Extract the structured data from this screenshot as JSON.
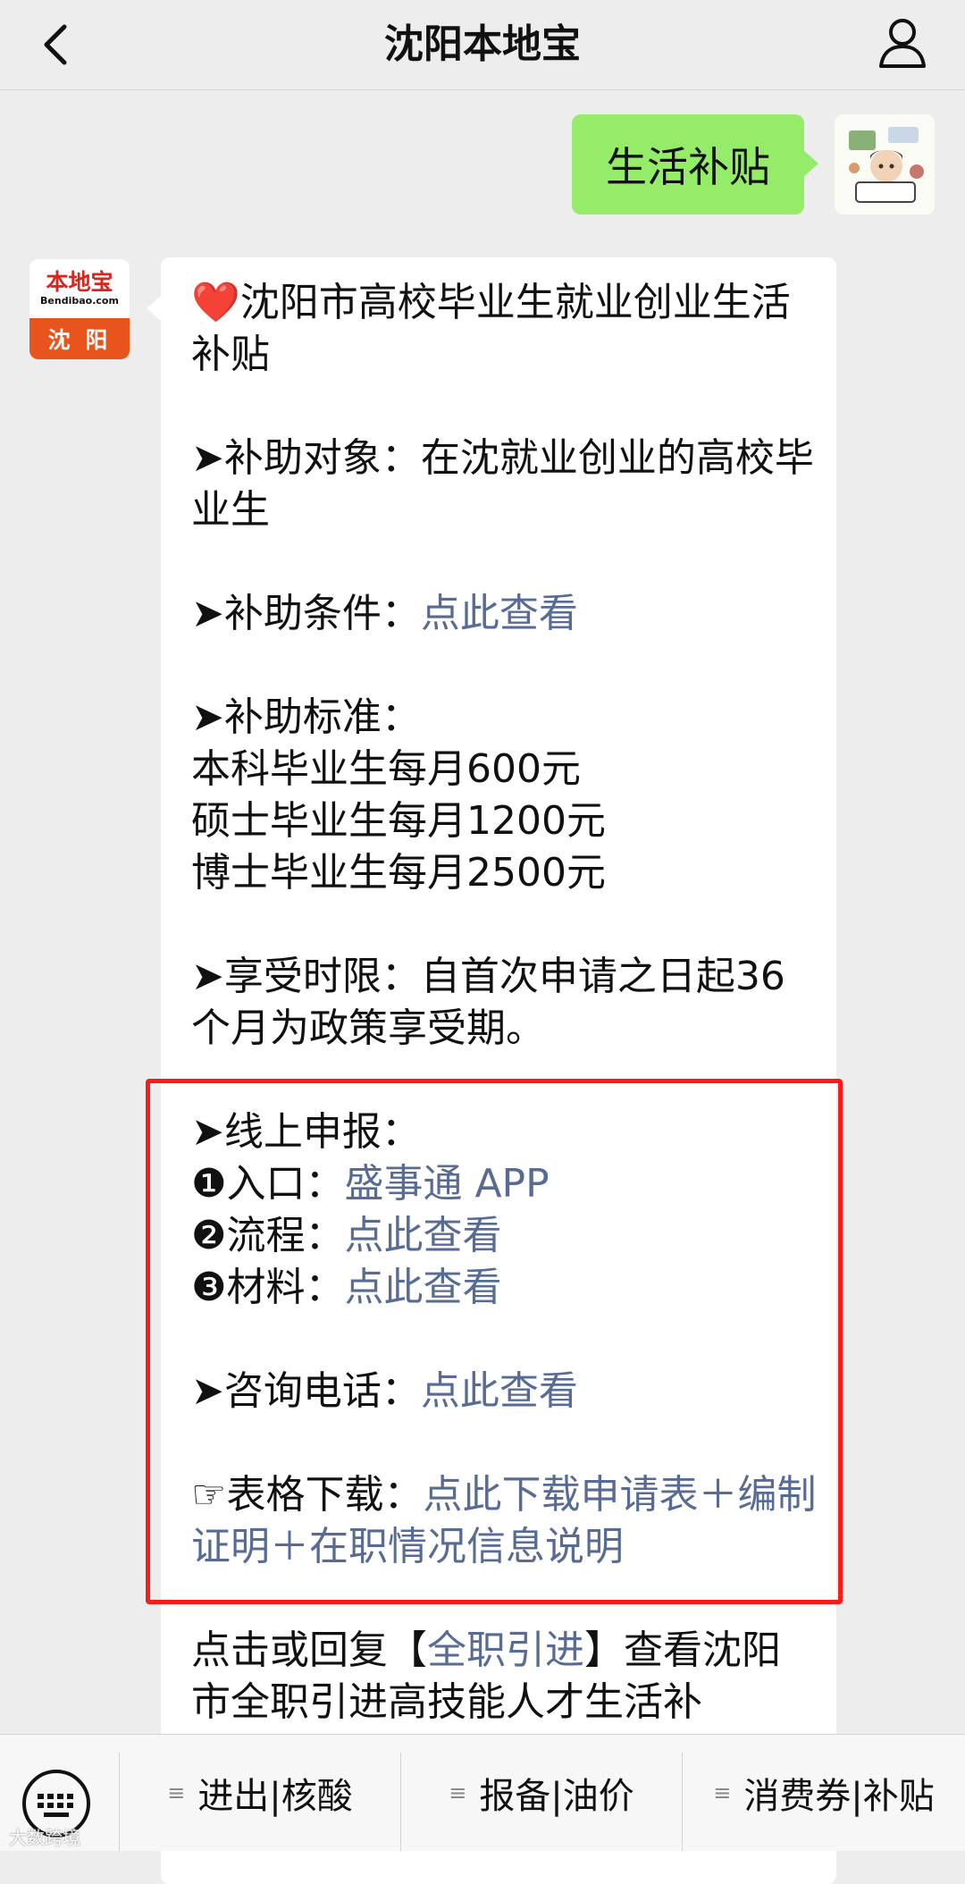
{
  "header": {
    "title": "沈阳本地宝"
  },
  "user_message": {
    "text": "生活补贴"
  },
  "bot_avatar": {
    "logo": "本地宝",
    "domain": "Bendibao.com",
    "city": "沈 阳"
  },
  "article": {
    "title": "❤️沈阳市高校毕业生就业创业生活补贴",
    "target_label": "➤补助对象：",
    "target_text": "在沈就业创业的高校毕业生",
    "conditions_label": "➤补助条件：",
    "conditions_link": "点此查看",
    "standard_label": "➤补助标准：",
    "standard_lines": [
      "本科毕业生每月600元",
      "硕士毕业生每月1200元",
      "博士毕业生每月2500元"
    ],
    "period_label": "➤享受时限：",
    "period_text": "自首次申请之日起36个月为政策享受期。",
    "online_label": "➤线上申报：",
    "entry_label": "❶入口：",
    "entry_link": "盛事通 APP",
    "process_label": "❷流程：",
    "process_link": "点此查看",
    "materials_label": "❸材料：",
    "materials_link": "点此查看",
    "phone_label": "➤咨询电话：",
    "phone_link": "点此查看",
    "download_label": "☞表格下载：",
    "download_link": "点此下载申请表＋编制证明＋在职情况信息说明",
    "footer_prefix": "点击或回复【",
    "footer_link": "全职引进",
    "footer_suffix": "】查看沈阳市全职引进高技能人才生活补"
  },
  "bottom_menu": {
    "items": [
      "进出|核酸",
      "报备|油价",
      "消费券|补贴"
    ]
  },
  "watermark": "大数跨境"
}
